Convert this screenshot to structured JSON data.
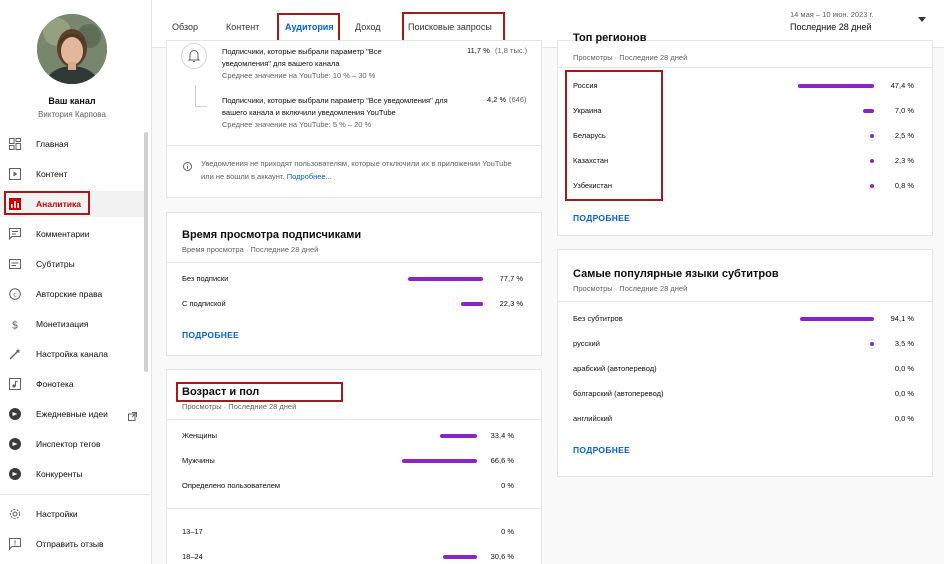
{
  "sidebar": {
    "channel_name": "Ваш канал",
    "channel_owner": "Виктория Карпова",
    "items": [
      {
        "label": "Главная",
        "icon": "dashboard-icon"
      },
      {
        "label": "Контент",
        "icon": "content-icon"
      },
      {
        "label": "Аналитика",
        "icon": "analytics-icon"
      },
      {
        "label": "Комментарии",
        "icon": "comments-icon"
      },
      {
        "label": "Субтитры",
        "icon": "subtitles-icon"
      },
      {
        "label": "Авторские права",
        "icon": "copyright-icon"
      },
      {
        "label": "Монетизация",
        "icon": "monetization-icon"
      },
      {
        "label": "Настройка канала",
        "icon": "customization-icon"
      },
      {
        "label": "Фонотека",
        "icon": "audio-library-icon"
      },
      {
        "label": "Ежедневные идеи",
        "icon": "ideas-icon"
      },
      {
        "label": "Инспектор тегов",
        "icon": "tags-icon"
      },
      {
        "label": "Конкуренты",
        "icon": "competitors-icon"
      },
      {
        "label": "Настройки",
        "icon": "settings-icon"
      },
      {
        "label": "Отправить отзыв",
        "icon": "feedback-icon"
      }
    ]
  },
  "tabs": [
    "Обзор",
    "Контент",
    "Аудитория",
    "Доход",
    "Поисковые запросы"
  ],
  "date": {
    "range": "14 мая – 10 июн. 2023 г.",
    "label": "Последние 28 дней"
  },
  "notifications": {
    "row1_text": "Подписчики, которые выбрали параметр \"Все уведомления\" для вашего канала",
    "row1_avg": "Среднее значение на YouTube: 10 % – 30 %",
    "row1_value": "11,7 %",
    "row1_count": "(1,8 тыс.)",
    "row2_text": "Подписчики, которые выбрали параметр \"Все уведомления\" для вашего канала и включили уведомления YouTube",
    "row2_avg": "Среднее значение на YouTube: 5 % – 20 %",
    "row2_value": "4,2 %",
    "row2_count": "(646)",
    "note": "Уведомления не приходят пользователям, которые отключили их в приложении YouTube или не вошли в аккаунт.",
    "note_link": "Подробнее..."
  },
  "watch_time": {
    "title": "Время просмотра подписчиками",
    "subtitle": "Время просмотра · Последние 28 дней",
    "rows": [
      {
        "label": "Без подписки",
        "value": "77,7 %",
        "pct": 77.7
      },
      {
        "label": "С подпиской",
        "value": "22,3 %",
        "pct": 22.3
      }
    ],
    "more": "ПОДРОБНЕЕ"
  },
  "age_gender": {
    "title": "Возраст и пол",
    "subtitle": "Просмотры · Последние 28 дней",
    "gender": [
      {
        "label": "Женщины",
        "value": "33,4 %",
        "pct": 33.4
      },
      {
        "label": "Мужчины",
        "value": "66,6 %",
        "pct": 66.6
      },
      {
        "label": "Определено пользователем",
        "value": "0 %",
        "pct": 0
      }
    ],
    "ages": [
      {
        "label": "13–17",
        "value": "0 %",
        "pct": 0
      },
      {
        "label": "18–24",
        "value": "30,6 %",
        "pct": 30.6
      }
    ]
  },
  "geography": {
    "title": "Топ регионов",
    "subtitle": "Просмотры · Последние 28 дней",
    "rows": [
      {
        "label": "Россия",
        "value": "47,4 %",
        "pct": 47.4
      },
      {
        "label": "Украина",
        "value": "7,0 %",
        "pct": 7.0
      },
      {
        "label": "Беларусь",
        "value": "2,5 %",
        "pct": 2.5
      },
      {
        "label": "Казахстан",
        "value": "2,3 %",
        "pct": 2.3
      },
      {
        "label": "Узбекистан",
        "value": "0,8 %",
        "pct": 0.8
      }
    ],
    "more": "ПОДРОБНЕЕ"
  },
  "subtitles": {
    "title": "Самые популярные языки субтитров",
    "subtitle": "Просмотры · Последние 28 дней",
    "rows": [
      {
        "label": "Без субтитров",
        "value": "94,1 %",
        "pct": 94.1
      },
      {
        "label": "русский",
        "value": "3,5 %",
        "pct": 3.5
      },
      {
        "label": "арабский (автоперевод)",
        "value": "0,0 %",
        "pct": 0.0
      },
      {
        "label": "болгарский (автоперевод)",
        "value": "0,0 %",
        "pct": 0.0
      },
      {
        "label": "английский",
        "value": "0,0 %",
        "pct": 0.0
      }
    ],
    "more": "ПОДРОБНЕЕ"
  },
  "colors": {
    "bar": "#8a24c7",
    "accent": "#065fd4",
    "highlight": "#a11b1b",
    "active_nav": "#cc0000"
  }
}
